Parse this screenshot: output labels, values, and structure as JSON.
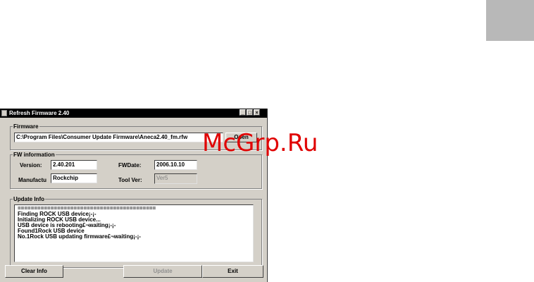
{
  "window": {
    "title": "Refresh Firmware 2.40",
    "controls": [
      "_",
      "□",
      "×"
    ]
  },
  "firmware": {
    "legend": "Firmware",
    "path": "C:\\Program Files\\Consumer Update Firmware\\Aneca2.40_fm.rfw",
    "open_label": "Open"
  },
  "fw_information": {
    "legend": "FW information",
    "version_label": "Version:",
    "version_value": "2.40.201",
    "fwdate_label": "FWDate:",
    "fwdate_value": "2006.10.10",
    "manufacturer_label": "Manufactu",
    "manufacturer_value": "Rockchip",
    "toolver_label": "Tool Ver:",
    "toolver_value": "Ver5"
  },
  "update_info": {
    "legend": "Update Info",
    "lines": [
      "==========================================",
      "Finding ROCK USB device¡-¡-",
      "Initializing ROCK USB device...",
      "USB device is rebooting£¬waiting¡-¡-",
      "Found1Rock USB device",
      "No.1Rock USB updating firmware£¬waiting¡-¡-"
    ]
  },
  "buttons": {
    "clear_info": "Clear Info",
    "update": "Update",
    "exit": "Exit"
  },
  "watermark": {
    "text": "McGrp.Ru",
    "color": "#e00000"
  },
  "colors": {
    "window_bg": "#d4d0c8",
    "titlebar_bg": "#000000"
  }
}
